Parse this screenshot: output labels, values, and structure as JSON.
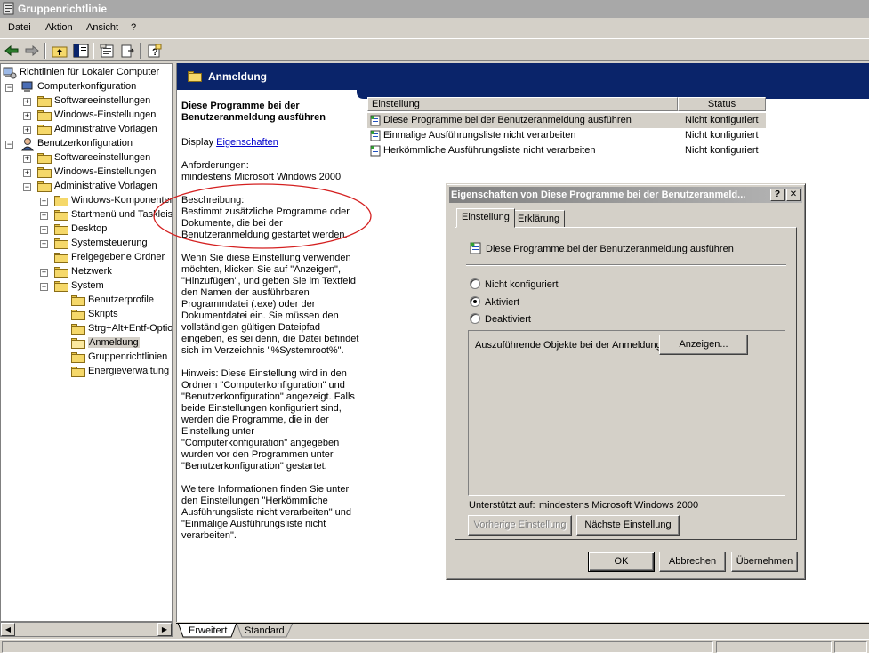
{
  "window": {
    "title": "Gruppenrichtlinie"
  },
  "menu": [
    "Datei",
    "Aktion",
    "Ansicht",
    "?"
  ],
  "toolbar": [
    "back-icon",
    "forward-icon",
    "up-folder-icon",
    "show-tree-icon",
    "properties-icon",
    "export-icon",
    "help-icon"
  ],
  "tree": {
    "root": "Richtlinien für Lokaler Computer",
    "items": [
      "Computerkonfiguration",
      "Softwareeinstellungen",
      "Windows-Einstellungen",
      "Administrative Vorlagen",
      "Benutzerkonfiguration",
      "Softwareeinstellungen",
      "Windows-Einstellungen",
      "Administrative Vorlagen",
      "Windows-Komponenten",
      "Startmenü und Taskleiste",
      "Desktop",
      "Systemsteuerung",
      "Freigegebene Ordner",
      "Netzwerk",
      "System",
      "Benutzerprofile",
      "Skripts",
      "Strg+Alt+Entf-Optionen",
      "Anmeldung",
      "Gruppenrichtlinien",
      "Energieverwaltung"
    ]
  },
  "pane": {
    "header": "Anmeldung"
  },
  "description": {
    "title": "Diese Programme bei der Benutzeranmeldung ausführen",
    "display_prefix": "Display",
    "display_link": "Eigenschaften",
    "requirements_label": "Anforderungen:",
    "requirements_value": "mindestens Microsoft Windows 2000",
    "desc_label": "Beschreibung:",
    "desc_text": "Bestimmt zusätzliche Programme oder Dokumente, die bei der Benutzeranmeldung gestartet werden.",
    "para1": "Wenn Sie diese Einstellung verwenden möchten, klicken Sie auf \"Anzeigen\", \"Hinzufügen\", und geben Sie im Textfeld den Namen der ausführbaren Programmdatei (.exe) oder der Dokumentdatei ein. Sie müssen den vollständigen gültigen Dateipfad eingeben, es sei denn, die Datei befindet sich im Verzeichnis \"%Systemroot%\".",
    "para2": "Hinweis: Diese Einstellung wird in den Ordnern \"Computerkonfiguration\" und \"Benutzerkonfiguration\" angezeigt. Falls beide Einstellungen konfiguriert sind, werden die Programme, die in der Einstellung unter \"Computerkonfiguration\" angegeben wurden vor den Programmen unter \"Benutzerkonfiguration\" gestartet.",
    "para3": "Weitere Informationen finden Sie unter den Einstellungen \"Herkömmliche Ausführungsliste nicht verarbeiten\" und \"Einmalige Ausführungsliste nicht verarbeiten\"."
  },
  "list": {
    "headers": {
      "setting": "Einstellung",
      "status": "Status"
    },
    "rows": [
      {
        "setting": "Diese Programme bei der Benutzeranmeldung ausführen",
        "status": "Nicht konfiguriert"
      },
      {
        "setting": "Einmalige Ausführungsliste nicht verarbeiten",
        "status": "Nicht konfiguriert"
      },
      {
        "setting": "Herkömmliche Ausführungsliste nicht verarbeiten",
        "status": "Nicht konfiguriert"
      }
    ]
  },
  "bottom_tabs": [
    "Erweitert",
    "Standard"
  ],
  "dialog": {
    "title": "Eigenschaften von Diese Programme bei der Benutzeranmeld...",
    "help_btn": "?",
    "close_btn": "✕",
    "tabs": [
      "Einstellung",
      "Erklärung"
    ],
    "policy_name": "Diese Programme bei der Benutzeranmeldung ausführen",
    "radios": [
      "Nicht konfiguriert",
      "Aktiviert",
      "Deaktiviert"
    ],
    "selected_radio": "Aktiviert",
    "items_label": "Auszuführende Objekte bei der Anmeldung",
    "show_button": "Anzeigen...",
    "supported_label": "Unterstützt auf:",
    "supported_value": "mindestens Microsoft Windows 2000",
    "prev_button": "Vorherige Einstellung",
    "next_button": "Nächste Einstellung",
    "ok": "OK",
    "cancel": "Abbrechen",
    "apply": "Übernehmen"
  },
  "colors": {
    "header_bg": "#0a246a",
    "annotation": "#d42020",
    "link": "#0000cc"
  }
}
